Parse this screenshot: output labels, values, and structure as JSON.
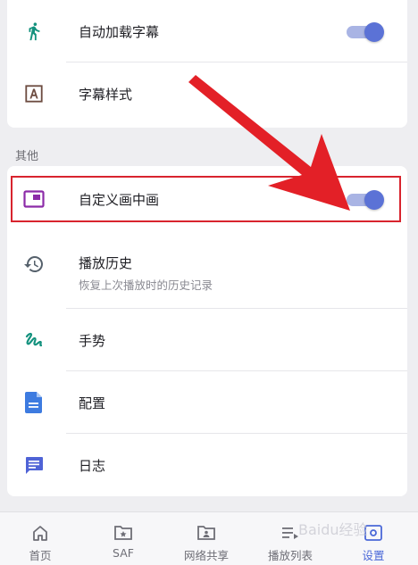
{
  "top_settings": [
    {
      "label": "自动加载字幕",
      "icon": "running-person-icon",
      "toggle_on": true
    },
    {
      "label": "字幕样式",
      "icon": "text-style-icon"
    }
  ],
  "section": {
    "title": "其他"
  },
  "main_settings": [
    {
      "label": "自定义画中画",
      "icon": "picture-in-picture-icon",
      "toggle_on": true
    },
    {
      "label": "播放历史",
      "sublabel": "恢复上次播放时的历史记录",
      "icon": "history-icon"
    },
    {
      "label": "手势",
      "icon": "gesture-icon"
    },
    {
      "label": "配置",
      "icon": "document-icon"
    },
    {
      "label": "日志",
      "icon": "message-log-icon"
    }
  ],
  "bottom_nav": [
    {
      "label": "首页",
      "icon": "home-icon"
    },
    {
      "label": "SAF",
      "icon": "folder-star-icon"
    },
    {
      "label": "网络共享",
      "icon": "folder-user-icon"
    },
    {
      "label": "播放列表",
      "icon": "playlist-icon"
    },
    {
      "label": "设置",
      "icon": "settings-icon",
      "active": true
    }
  ],
  "watermark": "Baidu经验",
  "colors": {
    "accent": "#5b72d6",
    "toggle_track": "#a9b4e4",
    "highlight": "#d8242e",
    "teal_icon": "#14927e",
    "purple_icon": "#8c2ba8",
    "brown_icon": "#6d4c41",
    "blue_icon": "#3d7be0",
    "indigo_icon": "#4f63d6",
    "grey_icon": "#55606b"
  }
}
